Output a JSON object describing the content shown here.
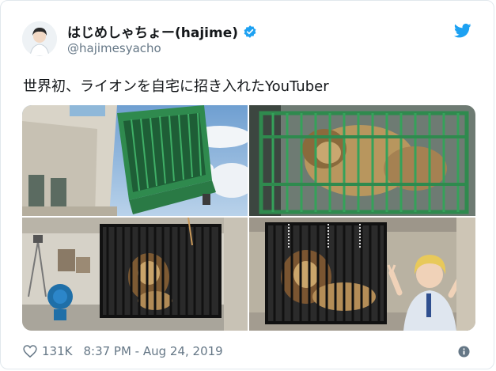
{
  "user": {
    "display_name": "はじめしゃちょー(hajime)",
    "handle": "@hajimesyacho"
  },
  "tweet": {
    "text": "世界初、ライオンを自宅に招き入れたYouTuber",
    "likes": "131K",
    "timestamp": "8:37 PM - Aug 24, 2019"
  },
  "icons": [
    "avatar",
    "verified-badge-icon",
    "twitter-bird-icon",
    "heart-icon",
    "info-icon"
  ],
  "colors": {
    "text": "#14171a",
    "secondary": "#657786",
    "brand": "#1da1f2",
    "cage": "#2f8a4e"
  }
}
